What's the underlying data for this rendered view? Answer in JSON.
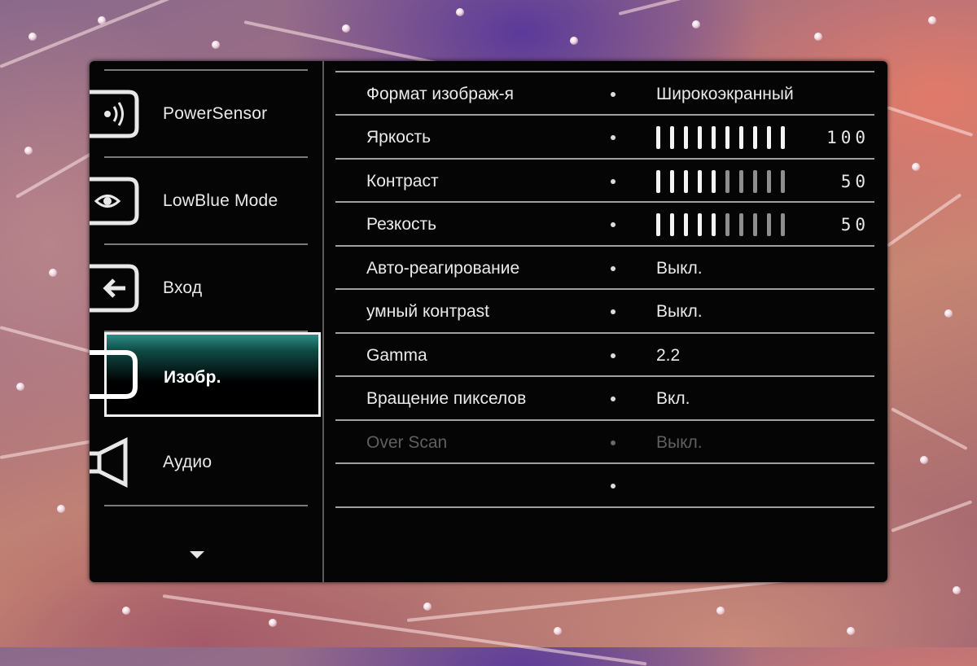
{
  "sidebar": {
    "items": [
      {
        "label": "PowerSensor",
        "icon": "power-sensor-icon"
      },
      {
        "label": "LowBlue Mode",
        "icon": "eye-icon"
      },
      {
        "label": "Вход",
        "icon": "input-arrow-icon"
      },
      {
        "label": "Изобр.",
        "icon": "picture-icon"
      },
      {
        "label": "Аудио",
        "icon": "speaker-icon"
      }
    ],
    "more_icon": "chevron-down-icon"
  },
  "settings": {
    "aspect": {
      "name": "Формат изображ-я",
      "value": "Широкоэкранный"
    },
    "brightness": {
      "name": "Яркость",
      "value": "100",
      "level": 100
    },
    "contrast": {
      "name": "Контраст",
      "value": "50",
      "level": 50
    },
    "sharpness": {
      "name": "Резкость",
      "value": "50",
      "level": 50
    },
    "auto_response": {
      "name": "Авто-реагирование",
      "value": "Выкл."
    },
    "smart_contrast": {
      "name": "умный контраst",
      "value": "Выкл."
    },
    "gamma": {
      "name": "Gamma",
      "value": "2.2"
    },
    "pixel_orbit": {
      "name": "Вращение пикселов",
      "value": "Вкл."
    },
    "over_scan": {
      "name": "Over Scan",
      "value": "Выкл.",
      "disabled": true
    }
  },
  "colors": {
    "panel": "#050505",
    "accent": "#1f7a73",
    "text": "#eaeaea",
    "disabled_text": "#5f5f5f"
  }
}
